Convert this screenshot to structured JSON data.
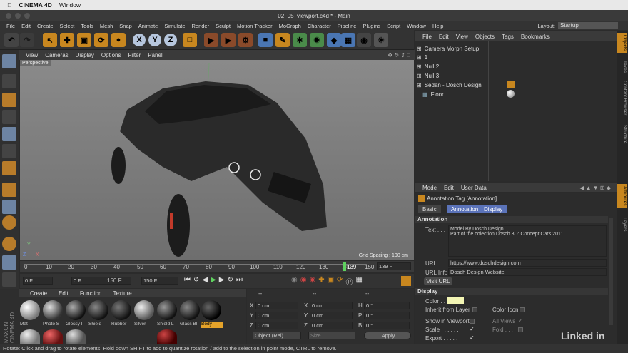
{
  "mac_menu": {
    "app": "CINEMA 4D",
    "window": "Window"
  },
  "title": "02_05_viewport.c4d * - Main",
  "menu": [
    "File",
    "Edit",
    "Create",
    "Select",
    "Tools",
    "Mesh",
    "Snap",
    "Animate",
    "Simulate",
    "Render",
    "Sculpt",
    "Motion Tracker",
    "MoGraph",
    "Character",
    "Pipeline",
    "Plugins",
    "Script",
    "Window",
    "Help"
  ],
  "layout": {
    "label": "Layout:",
    "value": "Startup"
  },
  "toolbar": {
    "x": "X",
    "y": "Y",
    "z": "Z"
  },
  "viewport": {
    "menu": [
      "View",
      "Cameras",
      "Display",
      "Options",
      "Filter",
      "Panel"
    ],
    "label": "Perspective",
    "grid_spacing": "Grid Spacing : 100 cm",
    "axis_y": "Y",
    "axis_z": "Z",
    "axis_x": "X"
  },
  "timeline": {
    "ticks": [
      "0",
      "10",
      "20",
      "30",
      "40",
      "50",
      "60",
      "70",
      "80",
      "90",
      "100",
      "110",
      "120",
      "130",
      "140",
      "150"
    ],
    "current": "139",
    "frame_field": "139 F"
  },
  "transport": {
    "start": "0 F",
    "cur": "0 F",
    "end": "150 F",
    "max": "150 F"
  },
  "materials": {
    "menu": [
      "Create",
      "Edit",
      "Function",
      "Texture"
    ],
    "row1": [
      "Mat",
      "Photo S",
      "Glossy I",
      "Shield",
      "Rubber",
      "Silver",
      "Shield L",
      "Glass Bl",
      "Body"
    ]
  },
  "coords": {
    "head": [
      "--",
      "--",
      "--"
    ],
    "rows": [
      {
        "a": "X",
        "av": "0 cm",
        "b": "X",
        "bv": "0 cm",
        "c": "H",
        "cv": "0 °"
      },
      {
        "a": "Y",
        "av": "0 cm",
        "b": "Y",
        "bv": "0 cm",
        "c": "P",
        "cv": "0 °"
      },
      {
        "a": "Z",
        "av": "0 cm",
        "b": "Z",
        "bv": "0 cm",
        "c": "B",
        "cv": "0 °"
      }
    ],
    "mode": "Object (Rel)",
    "size": "Size",
    "apply": "Apply"
  },
  "objects": {
    "menu": [
      "File",
      "Edit",
      "View",
      "Objects",
      "Tags",
      "Bookmarks"
    ],
    "items": [
      "Camera Morph Setup",
      "1",
      "Null 2",
      "Null 3",
      "Sedan - Dosch Design",
      "Floor"
    ]
  },
  "attributes": {
    "menu": [
      "Mode",
      "Edit",
      "User Data"
    ],
    "title": "Annotation Tag [Annotation]",
    "tabs": [
      "Basic",
      "Annotation",
      "Display"
    ],
    "section1": "Annotation",
    "text_label": "Text . . .",
    "text_line1": "Model By Dosch Design",
    "text_line2": "Part of the colection Dosch 3D: Concept Cars 2011",
    "url_label": "URL . . .",
    "url_value": "https://www.doschdesign.com",
    "urlinfo_label": "URL Info",
    "urlinfo_value": "Dosch Design Website",
    "visit_button": "Visit URL",
    "section2": "Display",
    "color_label": "Color . . .",
    "inherit": "Inherit from Layer",
    "color_icon": "Color Icon",
    "show_vp": "Show in Viewport",
    "all_views": "All Views",
    "scale": "Scale . . . . . .",
    "fold": "Fold . . .",
    "export": "Export . . . . ."
  },
  "side_tabs": [
    "Objects",
    "Takes",
    "Content Browser",
    "Structure",
    "Attributes",
    "Layers"
  ],
  "status": "Rotate: Click and drag to rotate elements. Hold down SHIFT to add to quantize rotation / add to the selection in point mode, CTRL to remove.",
  "watermark": "Linked in",
  "colors": {
    "accent": "#5b73b9",
    "orange": "#c8871f",
    "annotation_color": "#f3f5b4"
  }
}
